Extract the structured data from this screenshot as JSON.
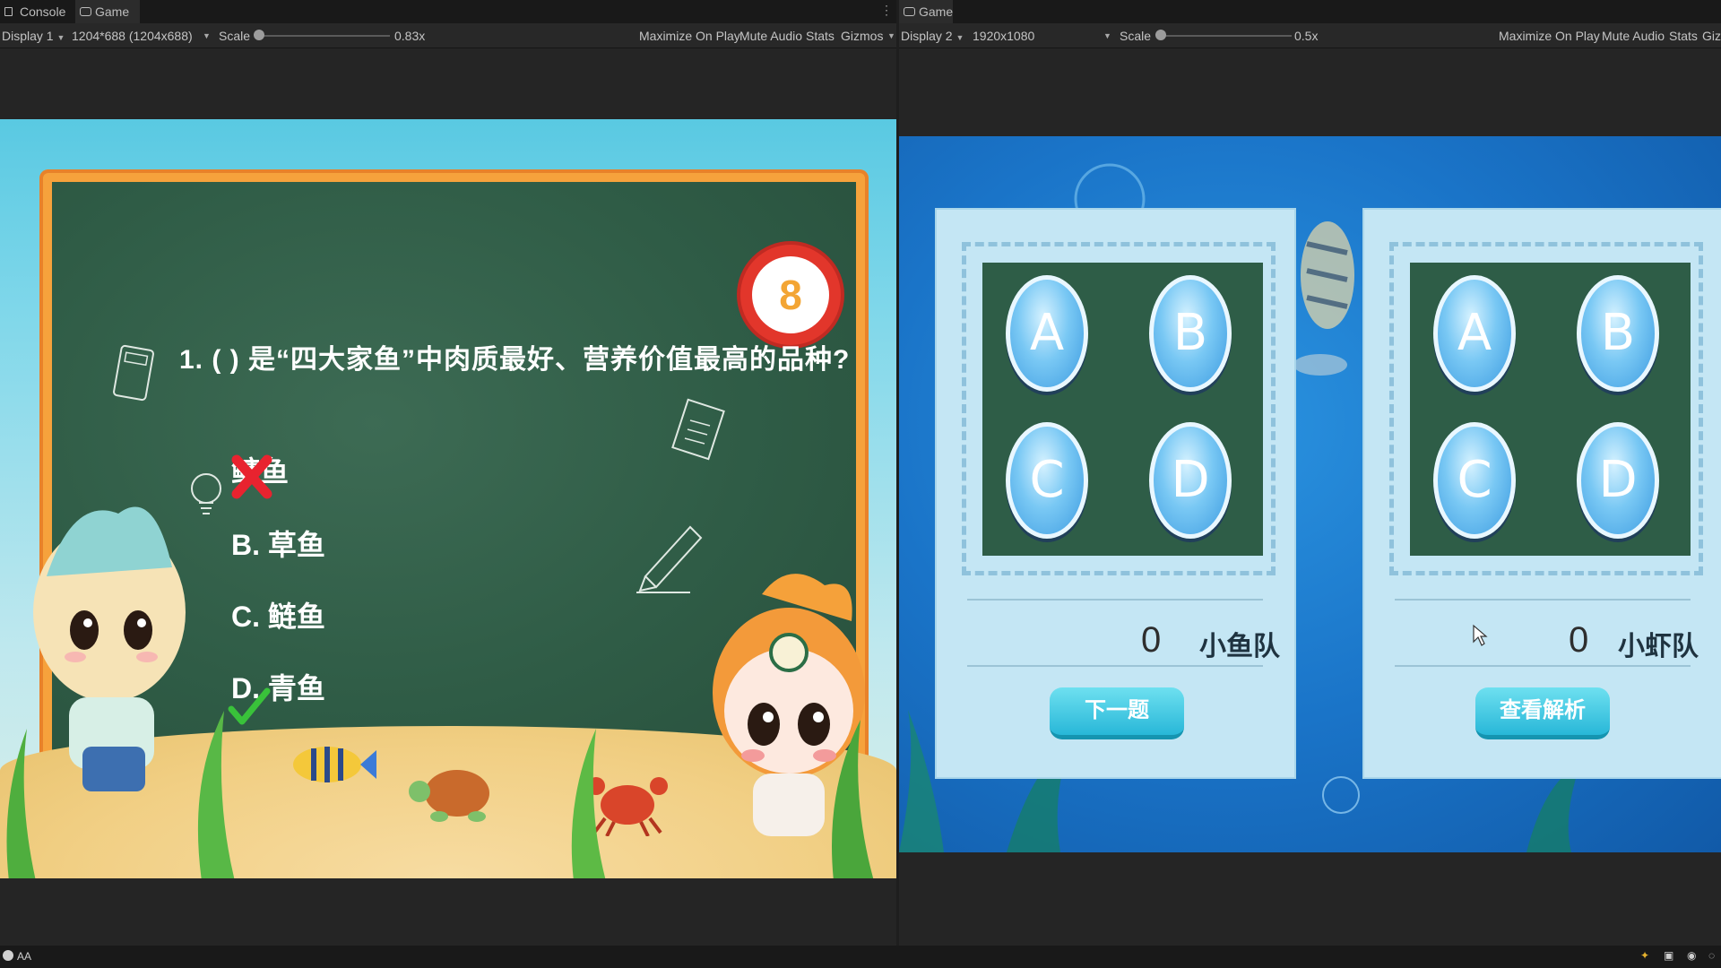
{
  "left_window": {
    "tabs": [
      {
        "label": "Console",
        "icon": "console-icon"
      },
      {
        "label": "Game",
        "icon": "gamepad-icon"
      }
    ],
    "toolbar": {
      "display": "Display 1",
      "resolution": "1204*688 (1204x688)",
      "scale_label": "Scale",
      "scale_value": "0.83x",
      "maximize": "Maximize On Play",
      "mute": "Mute Audio",
      "stats": "Stats",
      "gizmos": "Gizmos"
    },
    "quiz": {
      "question": "1. ( ) 是“四大家鱼”中肉质最好、营养价值最高的品种?",
      "timer": "8",
      "options": [
        {
          "letter": "",
          "text": "鳙鱼",
          "state": "wrong"
        },
        {
          "letter": "B.",
          "text": "草鱼",
          "state": ""
        },
        {
          "letter": "C.",
          "text": "鲢鱼",
          "state": ""
        },
        {
          "letter": "D.",
          "text": "青鱼",
          "state": "correct"
        }
      ]
    }
  },
  "right_window": {
    "tab": {
      "label": "Game",
      "icon": "gamepad-icon"
    },
    "toolbar": {
      "display": "Display 2",
      "resolution": "1920x1080",
      "scale_label": "Scale",
      "scale_value": "0.5x",
      "maximize": "Maximize On Play",
      "mute": "Mute Audio",
      "stats": "Stats",
      "gizmos": "Giz"
    },
    "panels": [
      {
        "buttons": [
          "A",
          "B",
          "C",
          "D"
        ],
        "score": "0",
        "team": "小鱼队",
        "action": "下一题"
      },
      {
        "buttons": [
          "A",
          "B",
          "C",
          "D"
        ],
        "score": "0",
        "team": "小虾队",
        "action": "查看解析"
      }
    ]
  },
  "statusbar": {
    "text": "AA"
  },
  "colors": {
    "board": "#2f5c46",
    "frame": "#f6a23c",
    "timer_ring": "#e2362b",
    "panel": "#c4e6f4",
    "ocean": "#1a74c8"
  }
}
